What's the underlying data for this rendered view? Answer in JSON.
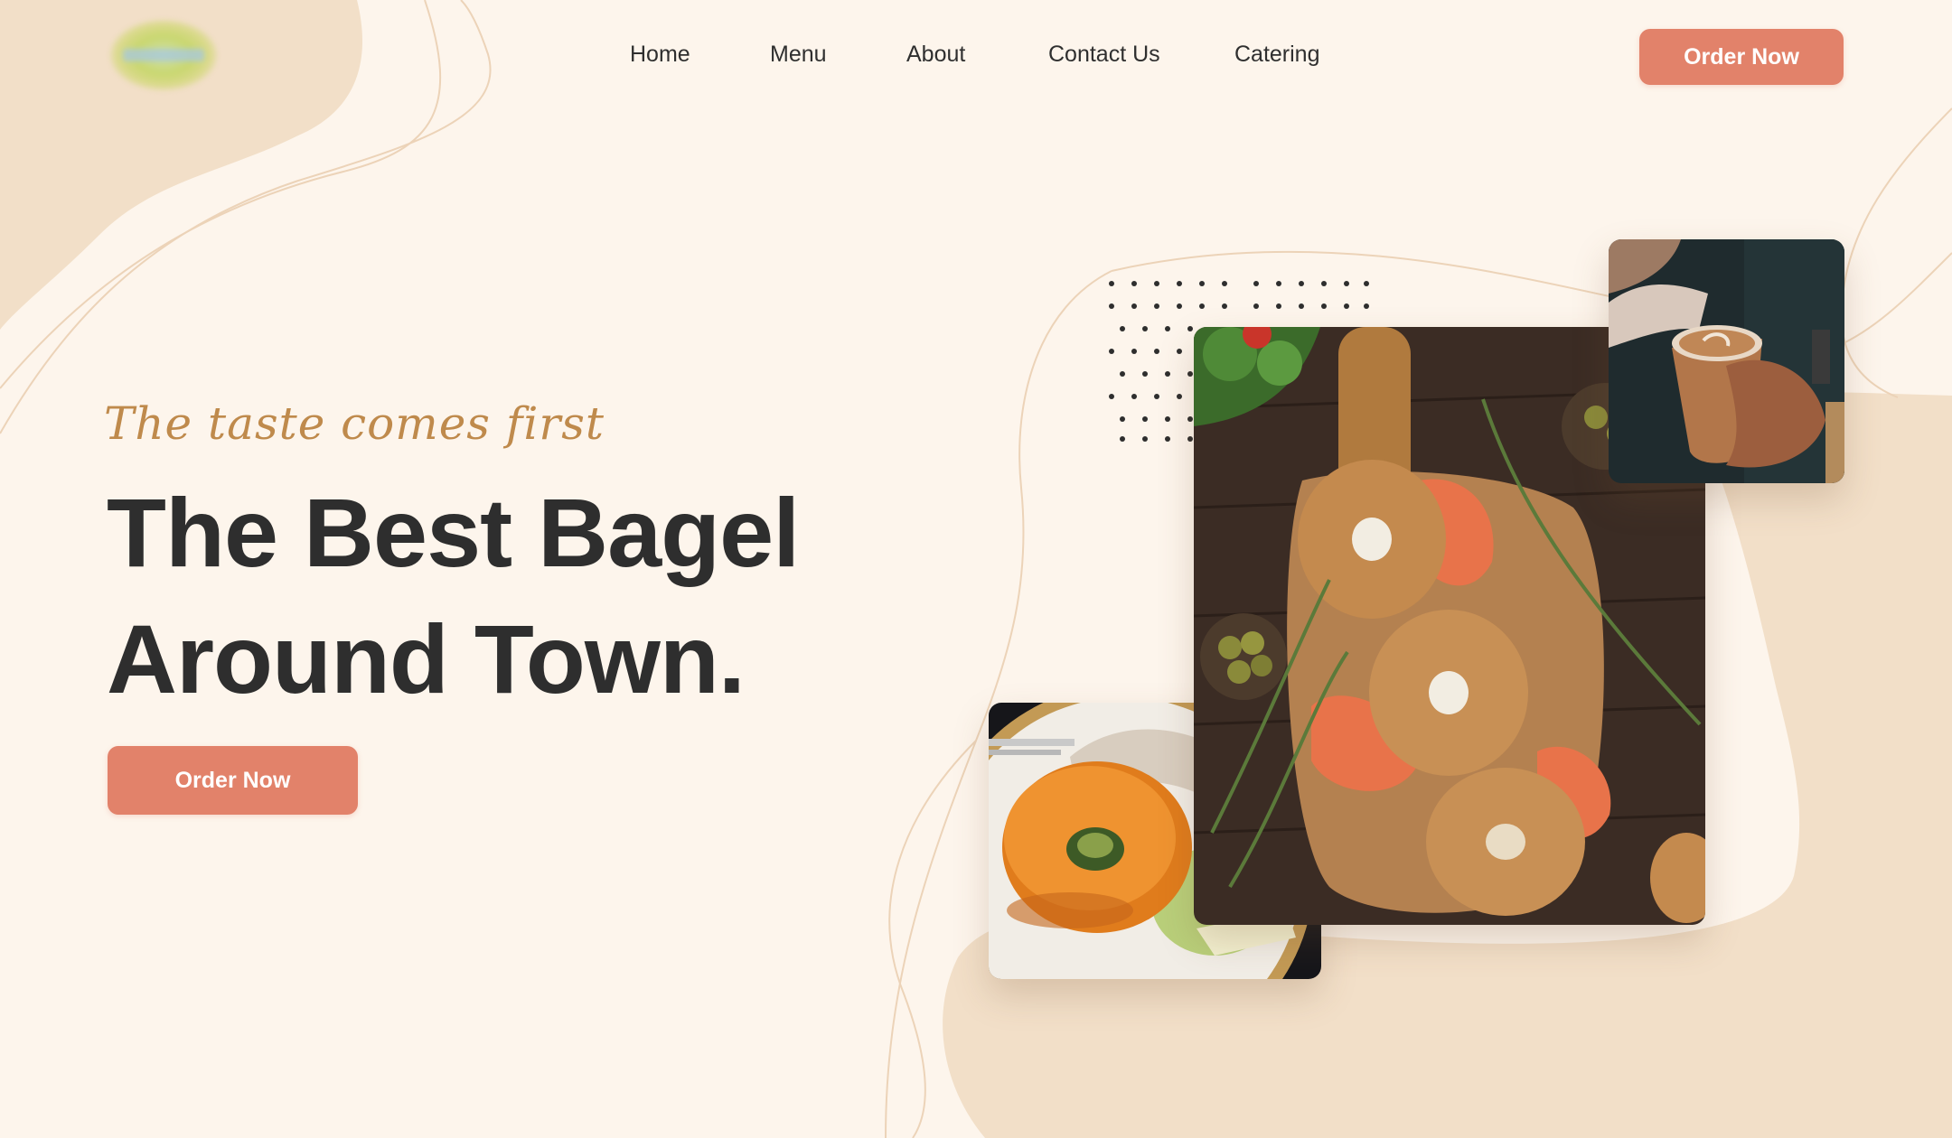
{
  "header": {
    "logo_icon": "bagel-logo-icon",
    "nav": [
      {
        "label": "Home"
      },
      {
        "label": "Menu"
      },
      {
        "label": "About"
      },
      {
        "label": "Contact Us"
      },
      {
        "label": "Catering"
      }
    ],
    "order_button": "Order Now"
  },
  "hero": {
    "tagline": "The taste comes first",
    "headline_line1": "The Best Bagel",
    "headline_line2": "Around Town.",
    "order_button": "Order Now"
  },
  "images": {
    "main": "bagels-with-salmon-on-board-image",
    "small": "bagel-sandwich-plate-image",
    "coffee": "latte-cup-in-hand-image"
  },
  "colors": {
    "background": "#fdf5ec",
    "blob": "#f2dfc8",
    "accent": "#e2826a",
    "tagline": "#bf8a4c",
    "headline": "#2e2e2e"
  }
}
